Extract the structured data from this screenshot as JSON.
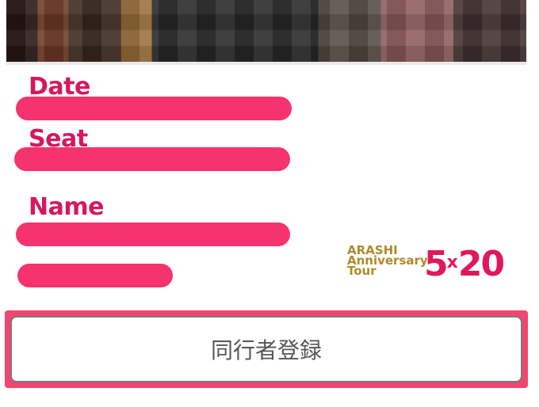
{
  "ticket": {
    "date_label": "Date",
    "seat_label": "Seat",
    "name_label": "Name"
  },
  "logo": {
    "line1": "ARASHI",
    "line2": "Anniversary",
    "line3": "Tour",
    "number_left": "5",
    "number_mid": "x",
    "number_right": "20"
  },
  "actions": {
    "register_companion_label": "同行者登録"
  },
  "colors": {
    "accent": "#d6175e",
    "redaction": "#f5336f",
    "frame": "#f0466f"
  }
}
